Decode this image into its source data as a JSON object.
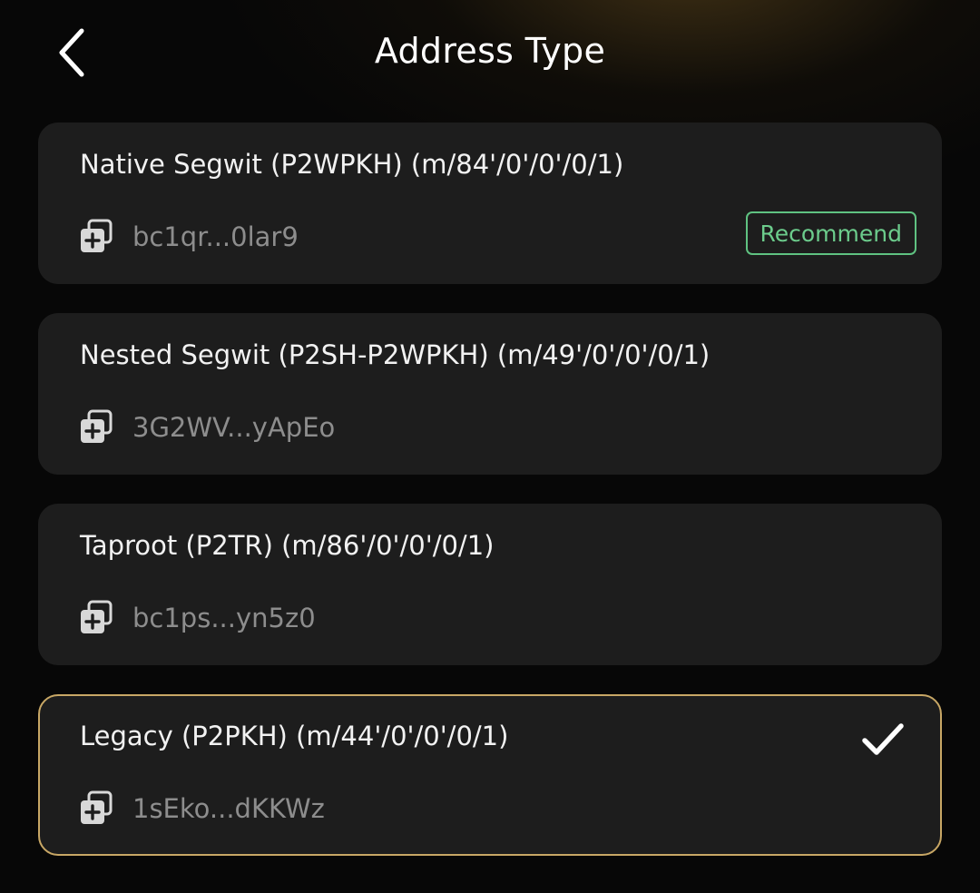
{
  "header": {
    "title": "Address Type",
    "back_icon": "chevron-left-icon"
  },
  "address_types": [
    {
      "title": "Native Segwit (P2WPKH) (m/84'/0'/0'/0/1)",
      "address": "bc1qr...0lar9",
      "badge": "Recommend",
      "selected": false
    },
    {
      "title": "Nested Segwit (P2SH-P2WPKH) (m/49'/0'/0'/0/1)",
      "address": "3G2WV...yApEo",
      "selected": false
    },
    {
      "title": "Taproot (P2TR) (m/86'/0'/0'/0/1)",
      "address": "bc1ps...yn5z0",
      "selected": false
    },
    {
      "title": "Legacy (P2PKH) (m/44'/0'/0'/0/1)",
      "address": "1sEko...dKKWz",
      "selected": true
    }
  ],
  "icons": {
    "copy": "copy-icon",
    "selected": "checkmark-icon"
  },
  "colors": {
    "background": "#070707",
    "card": "#1d1d1d",
    "selected_border": "#c8a765",
    "badge_green": "#5fc281",
    "address_text": "#8d8d8d"
  }
}
